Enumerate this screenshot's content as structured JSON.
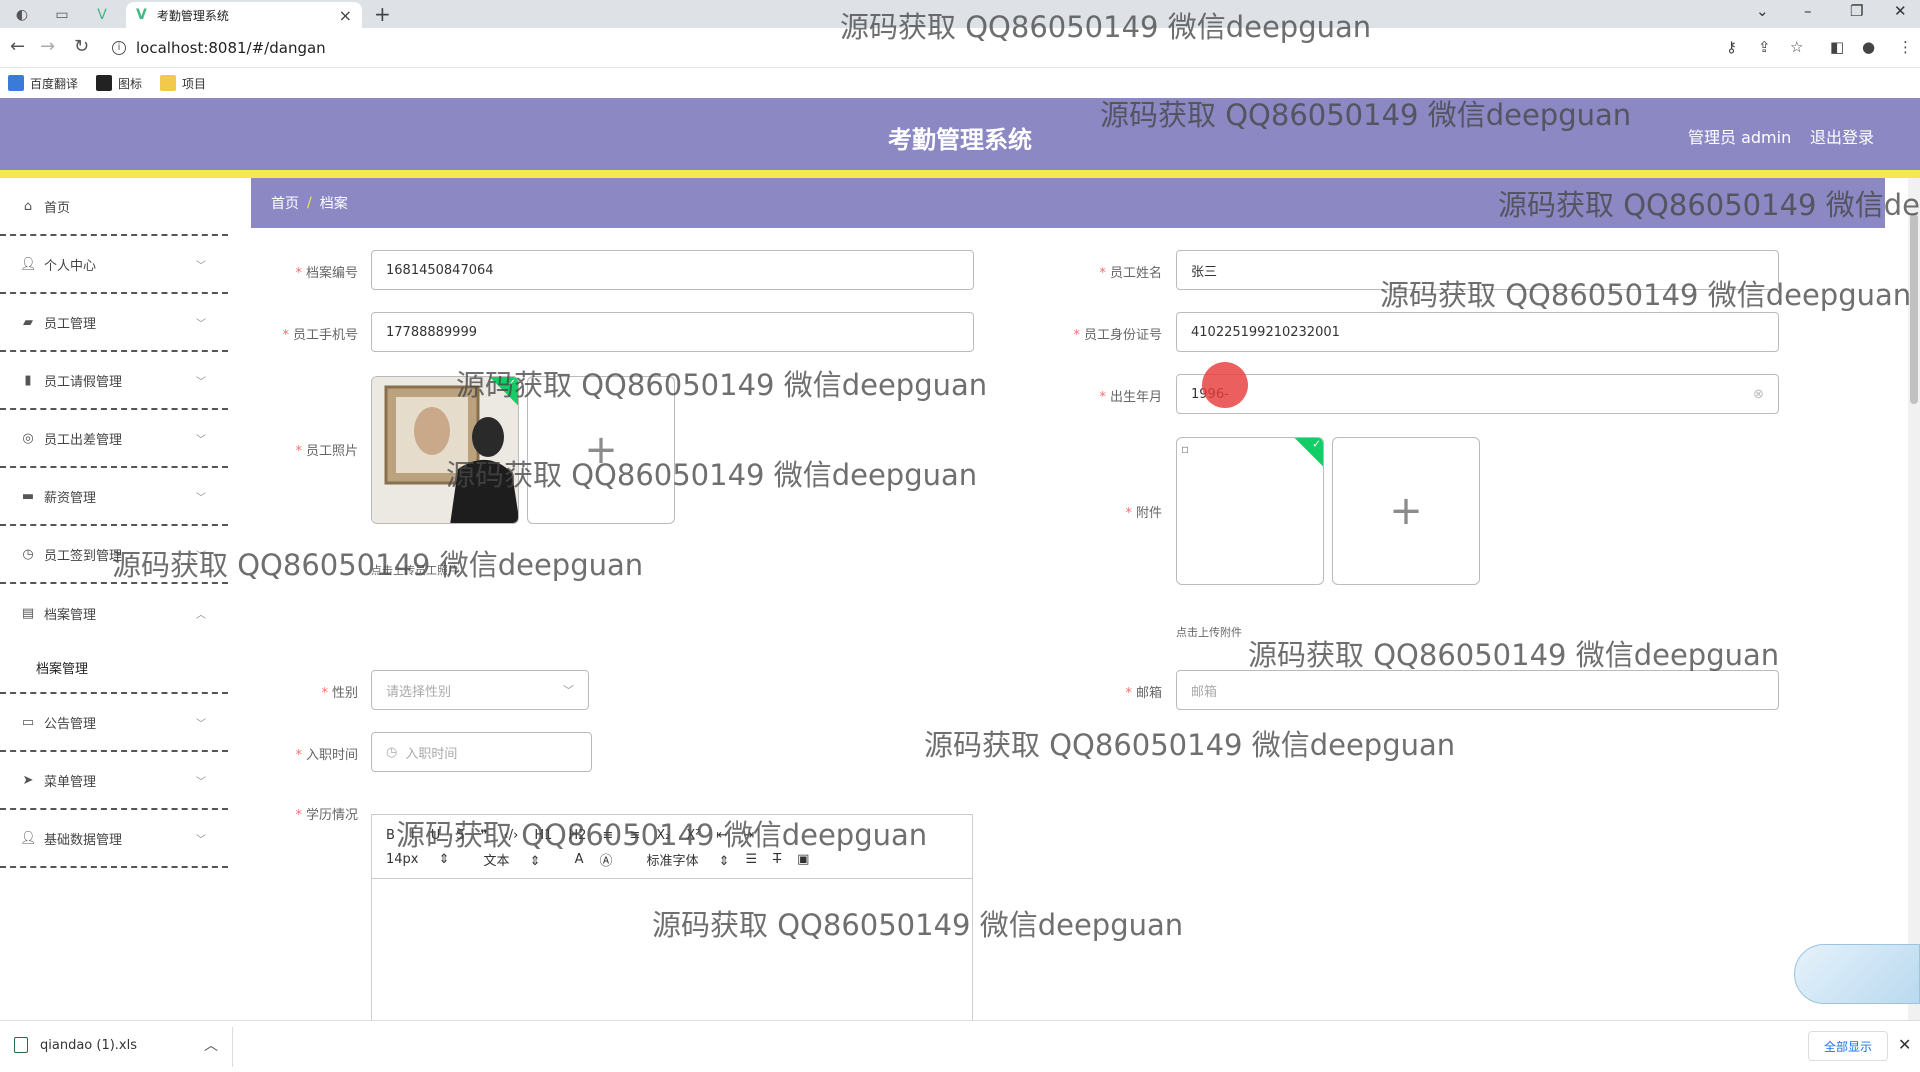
{
  "browser": {
    "tab_title": "考勤管理系统",
    "url": "localhost:8081/#/dangan",
    "bookmarks": [
      "百度翻译",
      "图标",
      "项目"
    ]
  },
  "header": {
    "title": "考勤管理系统",
    "user": "管理员 admin",
    "logout": "退出登录"
  },
  "sidebar": {
    "items": [
      {
        "label": "首页",
        "icon": "home-icon"
      },
      {
        "label": "个人中心",
        "icon": "user-icon"
      },
      {
        "label": "员工管理",
        "icon": "briefcase-icon"
      },
      {
        "label": "员工请假管理",
        "icon": "bar-chart-icon"
      },
      {
        "label": "员工出差管理",
        "icon": "globe-icon"
      },
      {
        "label": "薪资管理",
        "icon": "wallet-icon"
      },
      {
        "label": "员工签到管理",
        "icon": "clock-icon"
      },
      {
        "label": "档案管理",
        "icon": "clipboard-icon"
      },
      {
        "label": "公告管理",
        "icon": "monitor-icon"
      },
      {
        "label": "菜单管理",
        "icon": "send-icon"
      },
      {
        "label": "基础数据管理",
        "icon": "user-icon"
      }
    ],
    "sub_item": "档案管理"
  },
  "breadcrumb": {
    "home": "首页",
    "separator": "/",
    "current": "档案"
  },
  "form": {
    "archive_no_label": "档案编号",
    "archive_no": "1681450847064",
    "name_label": "员工姓名",
    "name": "张三",
    "phone_label": "员工手机号",
    "phone": "17788889999",
    "id_label": "员工身份证号",
    "id_no": "410225199210232001",
    "photo_label": "员工照片",
    "photo_hint": "点击上传员工照片",
    "birth_label": "出生年月",
    "birth": "1996-",
    "attachment_label": "附件",
    "attachment_hint": "点击上传附件",
    "gender_label": "性别",
    "gender_placeholder": "请选择性别",
    "email_label": "邮箱",
    "email_placeholder": "邮箱",
    "hire_label": "入职时间",
    "hire_placeholder": "入职时间",
    "education_label": "学历情况",
    "required_mark": "*"
  },
  "editor": {
    "toolbar_row1": [
      "B",
      "I",
      "U",
      "S",
      "❞",
      "‹/›",
      "H1",
      "H2",
      "≡",
      "≡",
      "X₂",
      "X²",
      "⇤",
      "⇥"
    ],
    "font_size": "14px",
    "text_style": "文本",
    "font_family": "标准字体"
  },
  "downloads": {
    "file": "qiandao (1).xls",
    "show_all": "全部显示"
  },
  "watermark_text": "源码获取 QQ86050149 微信deepguan"
}
